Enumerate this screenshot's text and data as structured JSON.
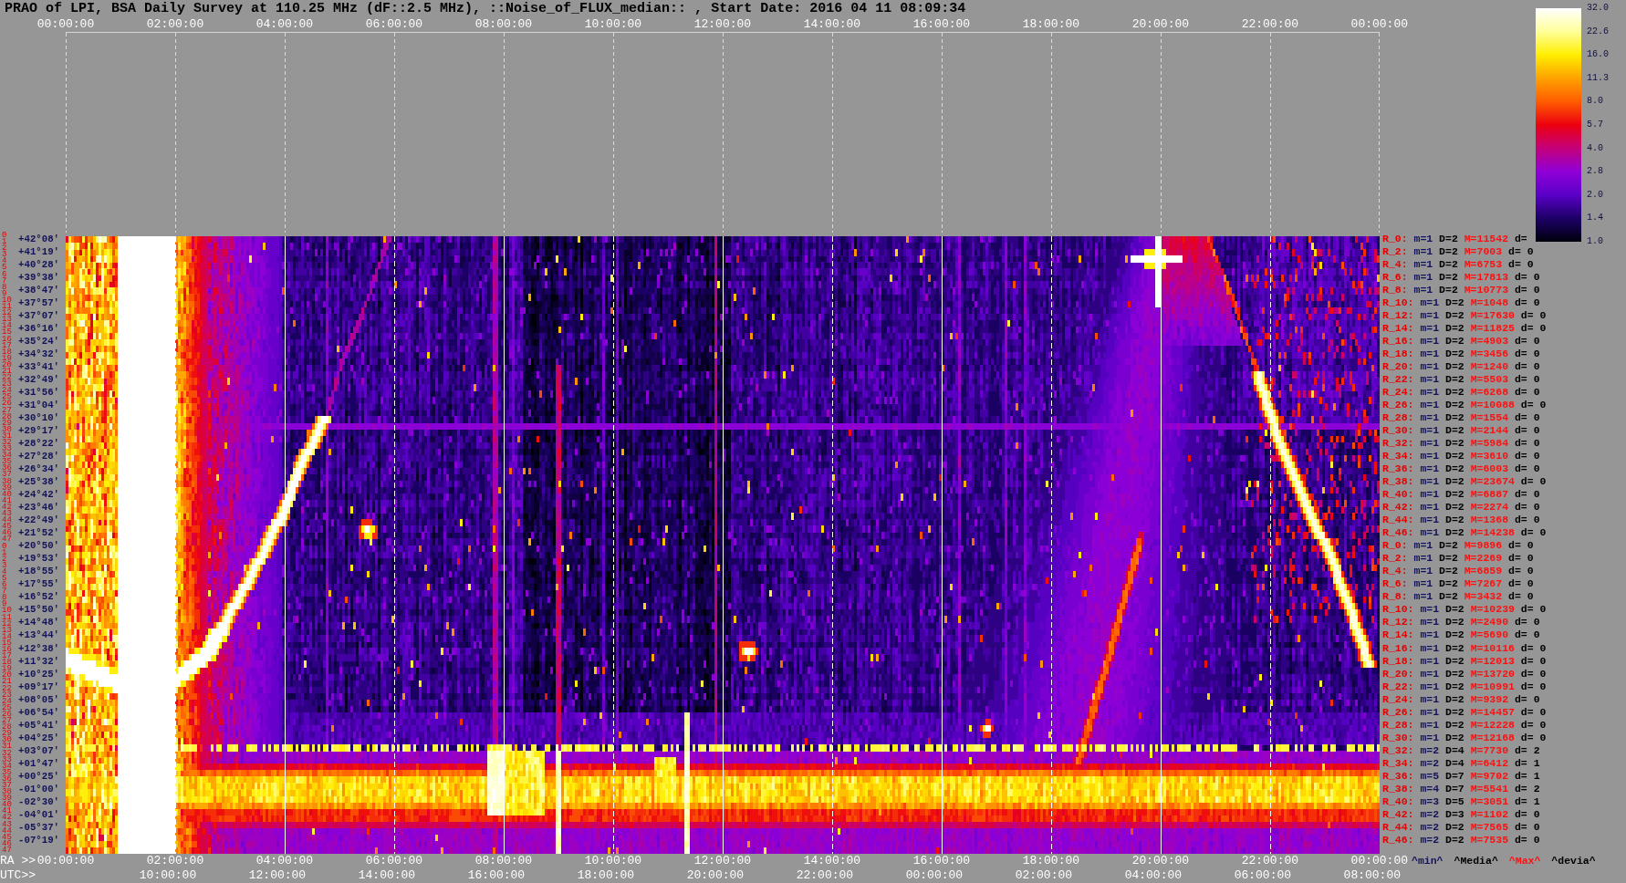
{
  "title": "PRAO of LPI, BSA Daily Survey at 110.25 MHz (dF::2.5 MHz), ::Noise_of_FLUX_median:: , Start Date: 2016 04 11 08:09:34",
  "top_axis": {
    "ticks": [
      "00:00:00",
      "02:00:00",
      "04:00:00",
      "06:00:00",
      "08:00:00",
      "10:00:00",
      "12:00:00",
      "14:00:00",
      "16:00:00",
      "18:00:00",
      "20:00:00",
      "22:00:00",
      "00:00:00"
    ]
  },
  "colorbar": {
    "ticks": [
      "32.0",
      "22.6",
      "16.0",
      "11.3",
      "8.0",
      "5.7",
      "4.0",
      "2.8",
      "2.0",
      "1.4",
      "1.0"
    ]
  },
  "row_numbers": [
    "0",
    "1",
    "2",
    "3",
    "4",
    "5",
    "6",
    "7",
    "8",
    "9",
    "10",
    "11",
    "12",
    "13",
    "14",
    "15",
    "16",
    "17",
    "18",
    "19",
    "20",
    "21",
    "22",
    "23",
    "24",
    "25",
    "26",
    "27",
    "28",
    "29",
    "30",
    "31",
    "32",
    "33",
    "34",
    "35",
    "36",
    "37",
    "38",
    "39",
    "40",
    "41",
    "42",
    "43",
    "44",
    "45",
    "46",
    "47",
    "0",
    "1",
    "2",
    "3",
    "4",
    "5",
    "6",
    "7",
    "8",
    "9",
    "10",
    "11",
    "12",
    "13",
    "14",
    "15",
    "16",
    "17",
    "18",
    "19",
    "20",
    "21",
    "22",
    "23",
    "24",
    "25",
    "26",
    "27",
    "28",
    "29",
    "30",
    "31",
    "32",
    "33",
    "34",
    "35",
    "36",
    "37",
    "38",
    "39",
    "40",
    "41",
    "42",
    "43",
    "44",
    "45",
    "46",
    "47"
  ],
  "declinations": [
    "+42°08'",
    "+41°19'",
    "+40°28'",
    "+39°38'",
    "+38°47'",
    "+37°57'",
    "+37°07'",
    "+36°16'",
    "+35°24'",
    "+34°32'",
    "+33°41'",
    "+32°49'",
    "+31°56'",
    "+31°04'",
    "+30°10'",
    "+29°17'",
    "+28°22'",
    "+27°28'",
    "+26°34'",
    "+25°38'",
    "+24°42'",
    "+23°46'",
    "+22°49'",
    "+21°52'",
    "+20°50'",
    "+19°53'",
    "+18°55'",
    "+17°55'",
    "+16°52'",
    "+15°50'",
    "+14°48'",
    "+13°44'",
    "+12°38'",
    "+11°32'",
    "+10°25'",
    "+09°17'",
    "+08°05'",
    "+06°54'",
    "+05°41'",
    "+04°25'",
    "+03°07'",
    "+01°47'",
    "+00°25'",
    "-01°00'",
    "-02°30'",
    "-04°01'",
    "-05°37'",
    "-07°19'"
  ],
  "row_stats": [
    {
      "name": "R_0:",
      "min": "m=1",
      "median": "D=2",
      "max": "M=11542",
      "deviation": "d="
    },
    {
      "name": "R_2:",
      "min": "m=1",
      "median": "D=2",
      "max": "M=7003",
      "deviation": "d= 0"
    },
    {
      "name": "R_4:",
      "min": "m=1",
      "median": "D=2",
      "max": "M=6753",
      "deviation": "d= 0"
    },
    {
      "name": "R_6:",
      "min": "m=1",
      "median": "D=2",
      "max": "M=17813",
      "deviation": "d= 0"
    },
    {
      "name": "R_8:",
      "min": "m=1",
      "median": "D=2",
      "max": "M=10773",
      "deviation": "d= 0"
    },
    {
      "name": "R_10:",
      "min": "m=1",
      "median": "D=2",
      "max": "M=1048",
      "deviation": "d= 0"
    },
    {
      "name": "R_12:",
      "min": "m=1",
      "median": "D=2",
      "max": "M=17630",
      "deviation": "d= 0"
    },
    {
      "name": "R_14:",
      "min": "m=1",
      "median": "D=2",
      "max": "M=11825",
      "deviation": "d= 0"
    },
    {
      "name": "R_16:",
      "min": "m=1",
      "median": "D=2",
      "max": "M=4903",
      "deviation": "d= 0"
    },
    {
      "name": "R_18:",
      "min": "m=1",
      "median": "D=2",
      "max": "M=3456",
      "deviation": "d= 0"
    },
    {
      "name": "R_20:",
      "min": "m=1",
      "median": "D=2",
      "max": "M=1240",
      "deviation": "d= 0"
    },
    {
      "name": "R_22:",
      "min": "m=1",
      "median": "D=2",
      "max": "M=5503",
      "deviation": "d= 0"
    },
    {
      "name": "R_24:",
      "min": "m=1",
      "median": "D=2",
      "max": "M=6268",
      "deviation": "d= 0"
    },
    {
      "name": "R_26:",
      "min": "m=1",
      "median": "D=2",
      "max": "M=10088",
      "deviation": "d= 0"
    },
    {
      "name": "R_28:",
      "min": "m=1",
      "median": "D=2",
      "max": "M=1554",
      "deviation": "d= 0"
    },
    {
      "name": "R_30:",
      "min": "m=1",
      "median": "D=2",
      "max": "M=2144",
      "deviation": "d= 0"
    },
    {
      "name": "R_32:",
      "min": "m=1",
      "median": "D=2",
      "max": "M=5984",
      "deviation": "d= 0"
    },
    {
      "name": "R_34:",
      "min": "m=1",
      "median": "D=2",
      "max": "M=3610",
      "deviation": "d= 0"
    },
    {
      "name": "R_36:",
      "min": "m=1",
      "median": "D=2",
      "max": "M=6003",
      "deviation": "d= 0"
    },
    {
      "name": "R_38:",
      "min": "m=1",
      "median": "D=2",
      "max": "M=23674",
      "deviation": "d= 0"
    },
    {
      "name": "R_40:",
      "min": "m=1",
      "median": "D=2",
      "max": "M=6887",
      "deviation": "d= 0"
    },
    {
      "name": "R_42:",
      "min": "m=1",
      "median": "D=2",
      "max": "M=2274",
      "deviation": "d= 0"
    },
    {
      "name": "R_44:",
      "min": "m=1",
      "median": "D=2",
      "max": "M=1368",
      "deviation": "d= 0"
    },
    {
      "name": "R_46:",
      "min": "m=1",
      "median": "D=2",
      "max": "M=14238",
      "deviation": "d= 0"
    },
    {
      "name": "R_0:",
      "min": "m=1",
      "median": "D=2",
      "max": "M=9896",
      "deviation": "d= 0"
    },
    {
      "name": "R_2:",
      "min": "m=1",
      "median": "D=2",
      "max": "M=2269",
      "deviation": "d= 0"
    },
    {
      "name": "R_4:",
      "min": "m=1",
      "median": "D=2",
      "max": "M=6859",
      "deviation": "d= 0"
    },
    {
      "name": "R_6:",
      "min": "m=1",
      "median": "D=2",
      "max": "M=7267",
      "deviation": "d= 0"
    },
    {
      "name": "R_8:",
      "min": "m=1",
      "median": "D=2",
      "max": "M=3432",
      "deviation": "d= 0"
    },
    {
      "name": "R_10:",
      "min": "m=1",
      "median": "D=2",
      "max": "M=10239",
      "deviation": "d= 0"
    },
    {
      "name": "R_12:",
      "min": "m=1",
      "median": "D=2",
      "max": "M=2490",
      "deviation": "d= 0"
    },
    {
      "name": "R_14:",
      "min": "m=1",
      "median": "D=2",
      "max": "M=5690",
      "deviation": "d= 0"
    },
    {
      "name": "R_16:",
      "min": "m=1",
      "median": "D=2",
      "max": "M=10116",
      "deviation": "d= 0"
    },
    {
      "name": "R_18:",
      "min": "m=1",
      "median": "D=2",
      "max": "M=12013",
      "deviation": "d= 0"
    },
    {
      "name": "R_20:",
      "min": "m=1",
      "median": "D=2",
      "max": "M=13720",
      "deviation": "d= 0"
    },
    {
      "name": "R_22:",
      "min": "m=1",
      "median": "D=2",
      "max": "M=10991",
      "deviation": "d= 0"
    },
    {
      "name": "R_24:",
      "min": "m=1",
      "median": "D=2",
      "max": "M=9392",
      "deviation": "d= 0"
    },
    {
      "name": "R_26:",
      "min": "m=1",
      "median": "D=2",
      "max": "M=14457",
      "deviation": "d= 0"
    },
    {
      "name": "R_28:",
      "min": "m=1",
      "median": "D=2",
      "max": "M=12228",
      "deviation": "d= 0"
    },
    {
      "name": "R_30:",
      "min": "m=1",
      "median": "D=2",
      "max": "M=12168",
      "deviation": "d= 0"
    },
    {
      "name": "R_32:",
      "min": "m=2",
      "median": "D=4",
      "max": "M=7730",
      "deviation": "d= 2"
    },
    {
      "name": "R_34:",
      "min": "m=2",
      "median": "D=4",
      "max": "M=6412",
      "deviation": "d= 1"
    },
    {
      "name": "R_36:",
      "min": "m=5",
      "median": "D=7",
      "max": "M=9702",
      "deviation": "d= 1"
    },
    {
      "name": "R_38:",
      "min": "m=4",
      "median": "D=7",
      "max": "M=5541",
      "deviation": "d= 2"
    },
    {
      "name": "R_40:",
      "min": "m=3",
      "median": "D=5",
      "max": "M=3051",
      "deviation": "d= 1"
    },
    {
      "name": "R_42:",
      "min": "m=2",
      "median": "D=3",
      "max": "M=1102",
      "deviation": "d= 0"
    },
    {
      "name": "R_44:",
      "min": "m=2",
      "median": "D=2",
      "max": "M=7565",
      "deviation": "d= 0"
    },
    {
      "name": "R_46:",
      "min": "m=2",
      "median": "D=2",
      "max": "M=7535",
      "deviation": "d= 0"
    }
  ],
  "ra_axis": {
    "label": "RA >>",
    "ticks": [
      "00:00:00",
      "02:00:00",
      "04:00:00",
      "06:00:00",
      "08:00:00",
      "10:00:00",
      "12:00:00",
      "14:00:00",
      "16:00:00",
      "18:00:00",
      "20:00:00",
      "22:00:00",
      "00:00:00"
    ]
  },
  "utc_axis": {
    "label": "UTC>>",
    "ticks": [
      "10:00:00",
      "12:00:00",
      "14:00:00",
      "16:00:00",
      "18:00:00",
      "20:00:00",
      "22:00:00",
      "00:00:00",
      "02:00:00",
      "04:00:00",
      "06:00:00",
      "08:00:00"
    ]
  },
  "stats_legend": [
    {
      "text": "^min^",
      "kind": "min"
    },
    {
      "text": "^Media^",
      "kind": "median"
    },
    {
      "text": "^Max^",
      "kind": "max"
    },
    {
      "text": "^devia^",
      "kind": "deviation"
    }
  ]
}
